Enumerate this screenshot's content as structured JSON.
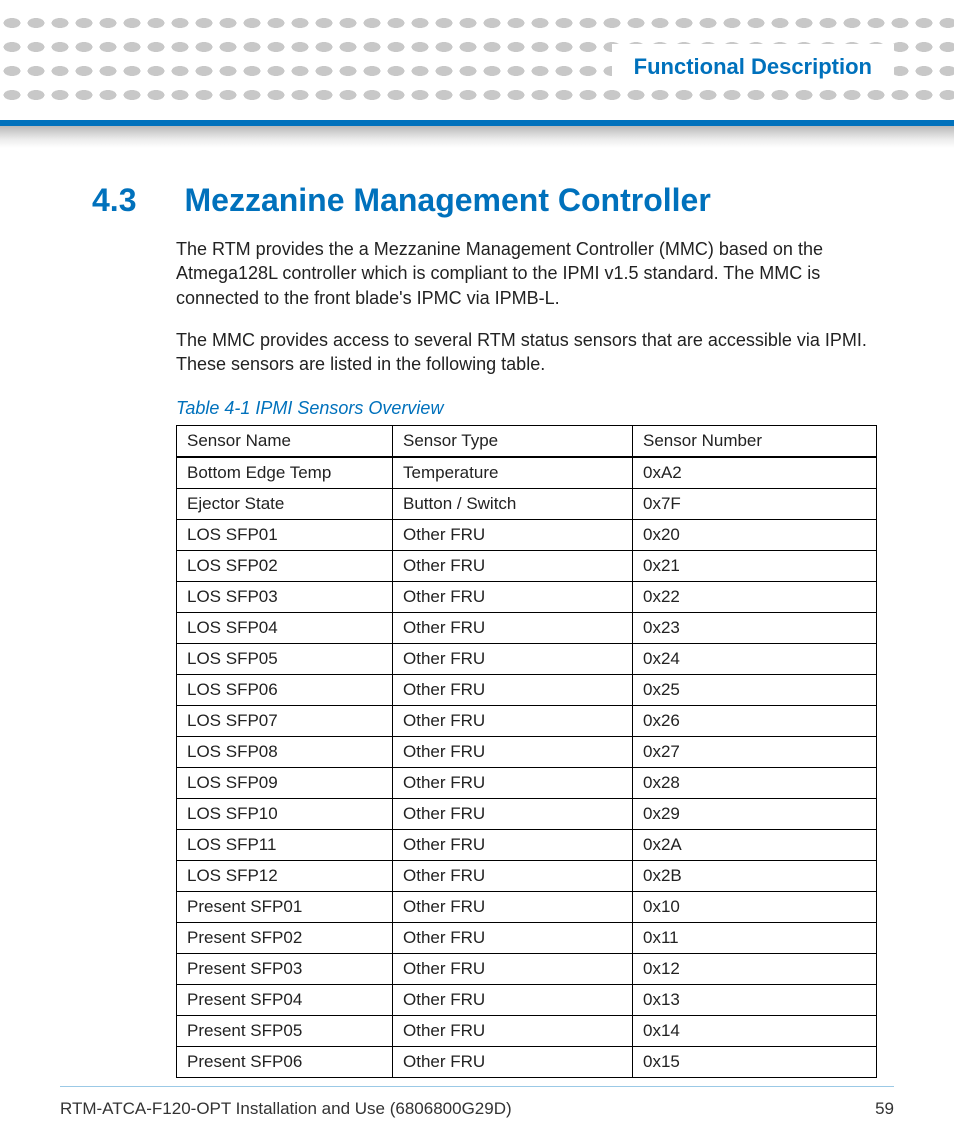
{
  "header": {
    "chapter_title": "Functional Description"
  },
  "section": {
    "number": "4.3",
    "title": "Mezzanine Management Controller",
    "paragraph1": "The RTM provides the a Mezzanine Management Controller (MMC) based on the Atmega128L controller which is compliant to the IPMI v1.5 standard. The MMC is connected to the front blade's IPMC via IPMB-L.",
    "paragraph2": "The MMC provides access to several RTM status sensors that are accessible via IPMI. These sensors are listed in the following table."
  },
  "table": {
    "caption": "Table 4-1 IPMI Sensors Overview",
    "headers": [
      "Sensor Name",
      "Sensor Type",
      "Sensor Number"
    ],
    "rows": [
      [
        "Bottom Edge Temp",
        "Temperature",
        "0xA2"
      ],
      [
        "Ejector State",
        "Button / Switch",
        "0x7F"
      ],
      [
        "LOS SFP01",
        "Other FRU",
        "0x20"
      ],
      [
        "LOS SFP02",
        "Other FRU",
        "0x21"
      ],
      [
        "LOS SFP03",
        "Other FRU",
        "0x22"
      ],
      [
        "LOS SFP04",
        "Other FRU",
        "0x23"
      ],
      [
        "LOS SFP05",
        "Other FRU",
        "0x24"
      ],
      [
        "LOS SFP06",
        "Other FRU",
        "0x25"
      ],
      [
        "LOS SFP07",
        "Other FRU",
        "0x26"
      ],
      [
        "LOS SFP08",
        "Other FRU",
        "0x27"
      ],
      [
        "LOS SFP09",
        "Other FRU",
        "0x28"
      ],
      [
        "LOS SFP10",
        "Other FRU",
        "0x29"
      ],
      [
        "LOS SFP11",
        "Other FRU",
        "0x2A"
      ],
      [
        "LOS SFP12",
        "Other FRU",
        "0x2B"
      ],
      [
        "Present SFP01",
        "Other FRU",
        "0x10"
      ],
      [
        "Present SFP02",
        "Other FRU",
        "0x11"
      ],
      [
        "Present SFP03",
        "Other FRU",
        "0x12"
      ],
      [
        "Present SFP04",
        "Other FRU",
        "0x13"
      ],
      [
        "Present SFP05",
        "Other FRU",
        "0x14"
      ],
      [
        "Present SFP06",
        "Other FRU",
        "0x15"
      ]
    ]
  },
  "footer": {
    "doc_title": "RTM-ATCA-F120-OPT Installation and Use (6806800G29D)",
    "page_number": "59"
  }
}
